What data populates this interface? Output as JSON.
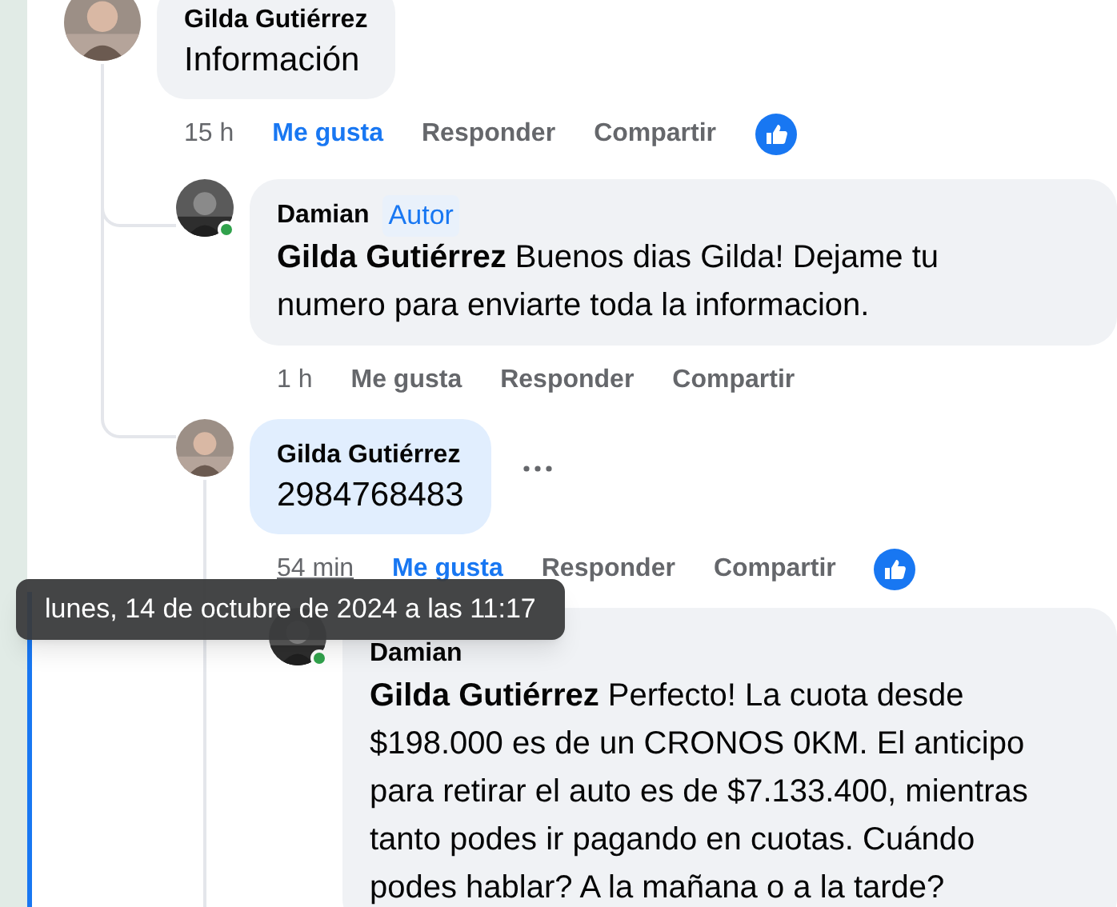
{
  "comments": [
    {
      "author": "Gilda Gutiérrez",
      "text": "Información",
      "time": "15 h",
      "time_hovered": false,
      "actions": [
        {
          "label": "Me gusta",
          "kind": "like",
          "liked": true
        },
        {
          "label": "Responder",
          "kind": "reply"
        },
        {
          "label": "Compartir",
          "kind": "share"
        }
      ],
      "reacted": true,
      "children": [
        {
          "author": "Damian",
          "badge": "Autor",
          "mention": "Gilda Gutiérrez",
          "text": "Buenos dias Gilda! Dejame tu numero para enviarte toda la informacion.",
          "online": true,
          "time": "1 h",
          "time_hovered": false,
          "actions": [
            {
              "label": "Me gusta",
              "kind": "like",
              "liked": false
            },
            {
              "label": "Responder",
              "kind": "reply"
            },
            {
              "label": "Compartir",
              "kind": "share"
            }
          ]
        },
        {
          "author": "Gilda Gutiérrez",
          "text": "2984768483",
          "highlighted": true,
          "time": "54 min",
          "time_hovered": true,
          "actions": [
            {
              "label": "Me gusta",
              "kind": "like",
              "liked": true
            },
            {
              "label": "Responder",
              "kind": "reply"
            },
            {
              "label": "Compartir",
              "kind": "share"
            }
          ],
          "reacted": true,
          "more_menu": true,
          "children": [
            {
              "author": "Damian",
              "mention": "Gilda Gutiérrez",
              "text": "Perfecto! La cuota desde $198.000 es de un CRONOS 0KM. El anticipo para retirar el auto es de $7.133.400, mientras tanto podes ir pagando en cuotas. Cuándo podes hablar? A la mañana o a la tarde?",
              "online": true
            }
          ]
        }
      ]
    }
  ],
  "tooltip": {
    "text": "lunes, 14 de octubre de 2024 a las 11:17"
  }
}
